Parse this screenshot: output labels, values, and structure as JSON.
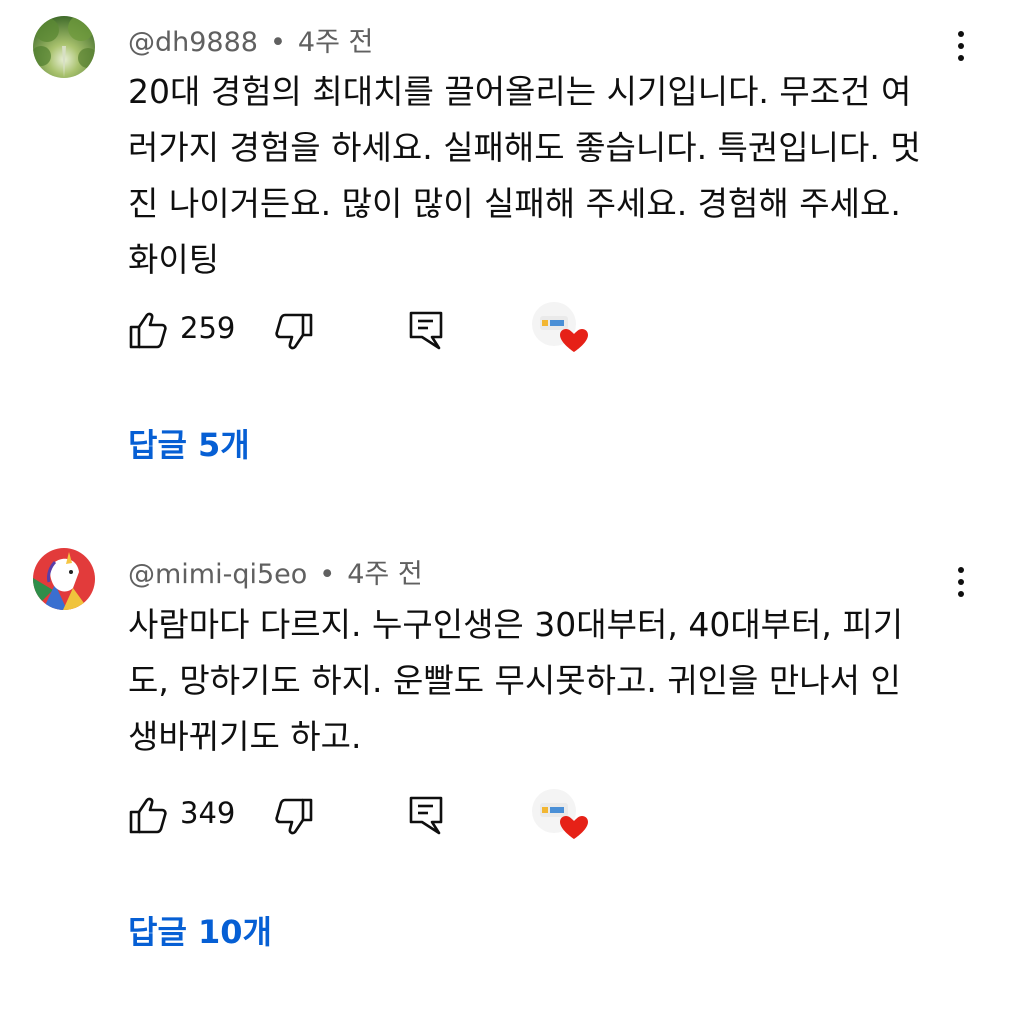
{
  "comments": [
    {
      "author": "@dh9888",
      "separator": "•",
      "time": "4주 전",
      "lines": [
        "20대 경험의 최대치를 끌어올리는 시기입니다. 무조건 여",
        "러가지 경험을 하세요. 실패해도 좋습니다. 특권입니다. 멋",
        "진 나이거든요. 많이 많이 실패해 주세요. 경험해 주세요.",
        "화이팅"
      ],
      "likes": "259",
      "replies": "답글 5개",
      "avatar_icon": "green-forest-avatar"
    },
    {
      "author": "@mimi-qi5eo",
      "separator": "•",
      "time": "4주 전",
      "lines": [
        "사람마다 다르지. 누구인생은 30대부터, 40대부터, 피기",
        "도, 망하기도 하지. 운빨도 무시못하고. 귀인을 만나서 인",
        "생바뀌기도 하고."
      ],
      "likes": "349",
      "replies": "답글 10개",
      "avatar_icon": "unicorn-avatar"
    }
  ],
  "colors": {
    "text": "#0f0f0f",
    "meta": "#606060",
    "link": "#065fd4",
    "heart": "#e62117"
  },
  "icons": [
    "thumbs-up-icon",
    "thumbs-down-icon",
    "reply-icon",
    "creator-heart-icon",
    "more-vert-icon"
  ]
}
